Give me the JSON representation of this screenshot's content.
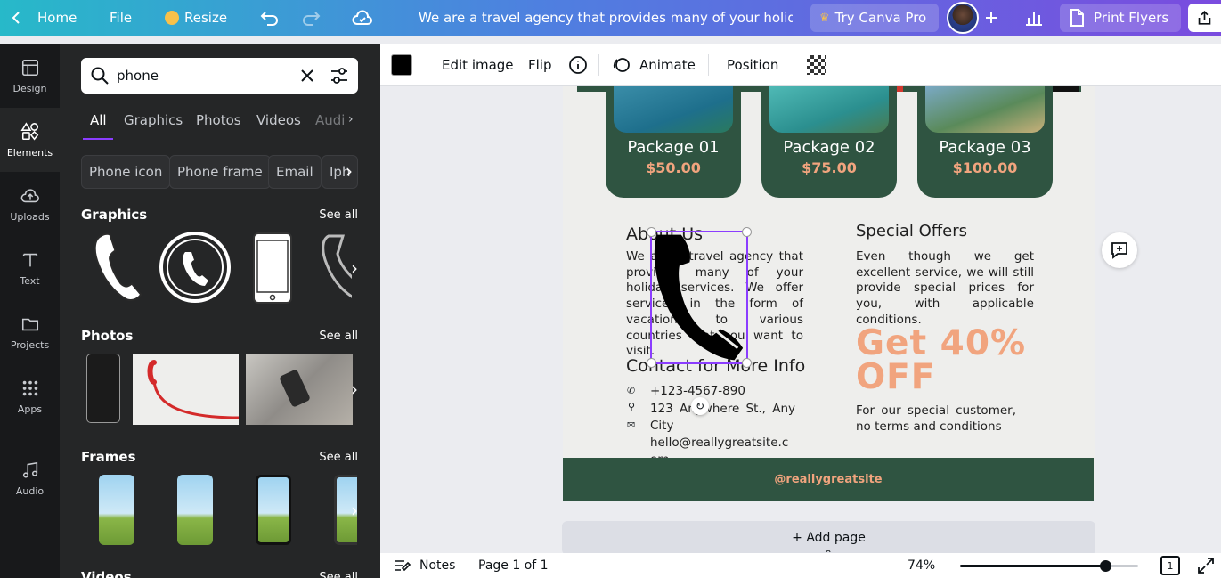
{
  "topbar": {
    "home_label": "Home",
    "file_label": "File",
    "resize_label": "Resize",
    "doc_title": "We are a travel agency that provides many of your holiday s...",
    "try_pro_label": "Try Canva Pro",
    "print_label": "Print Flyers"
  },
  "sidebar": {
    "items": [
      {
        "label": "Design"
      },
      {
        "label": "Elements"
      },
      {
        "label": "Uploads"
      },
      {
        "label": "Text"
      },
      {
        "label": "Projects"
      },
      {
        "label": "Apps"
      },
      {
        "label": "Audio"
      }
    ]
  },
  "panel": {
    "search_value": "phone",
    "tabs": [
      "All",
      "Graphics",
      "Photos",
      "Videos",
      "Audi"
    ],
    "chips": [
      "Phone icon",
      "Phone frame",
      "Email",
      "Iph"
    ],
    "sections": {
      "graphics": "Graphics",
      "photos": "Photos",
      "frames": "Frames",
      "videos": "Videos"
    },
    "see_all": "See all"
  },
  "context_toolbar": {
    "edit_image": "Edit image",
    "flip": "Flip",
    "animate": "Animate",
    "position": "Position",
    "color_swatch": "#000000"
  },
  "design": {
    "packages": [
      {
        "name": "Package 01",
        "price": "$50.00"
      },
      {
        "name": "Package 02",
        "price": "$75.00"
      },
      {
        "name": "Package 03",
        "price": "$100.00"
      }
    ],
    "about_title": "About Us",
    "about_text": "We are a travel agency that provides many of your holiday services. We offer services in the form of vacations to various countries that you want to visit.",
    "contact_title": "Contact for More Info",
    "phone": "+123-4567-890",
    "address": "123 Anywhere St., Any City",
    "email": "hello@reallygreatsite.com",
    "offers_title": "Special Offers",
    "offers_text": "Even though we get excellent service, we will still provide special prices for you, with applicable conditions.",
    "discount": "Get 40% OFF",
    "discount_note": "For our special customer, no terms and conditions",
    "footer": "@reallygreatsite",
    "accent": "#f1a47e",
    "green": "#2f5441"
  },
  "add_page_label": "+ Add page",
  "bottombar": {
    "notes": "Notes",
    "page_indicator": "Page 1 of 1",
    "zoom": "74%",
    "zoom_fraction": 0.74,
    "page_count": "1"
  }
}
